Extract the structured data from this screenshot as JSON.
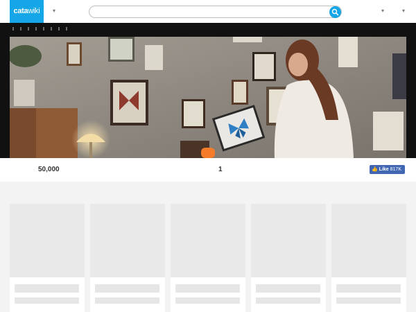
{
  "header": {
    "logo_part1": "cata",
    "logo_part2": "wiki",
    "search_placeholder": "",
    "icons": [
      "chevron-down-icon",
      "search-icon",
      "chevron-down-icon",
      "chevron-down-icon"
    ]
  },
  "stats": {
    "count_a": "50,000",
    "count_b": "1"
  },
  "facebook": {
    "like_label": "Like",
    "like_count": "817K"
  },
  "colors": {
    "brand": "#15a6e8",
    "facebook": "#4267b2"
  }
}
